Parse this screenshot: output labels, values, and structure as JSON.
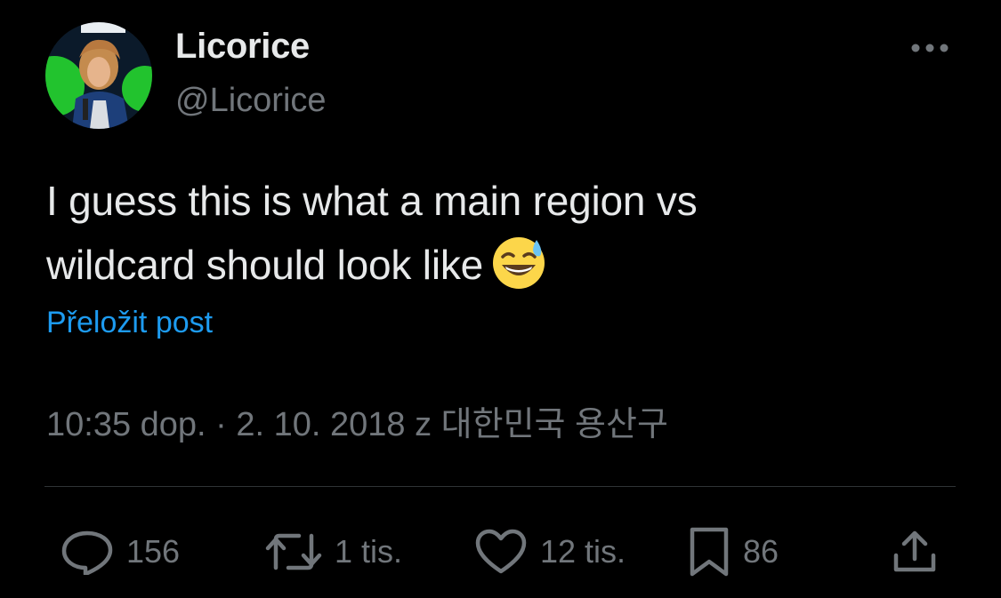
{
  "author": {
    "display_name": "Licorice",
    "handle": "@Licorice",
    "avatar_icon": "profile-photo"
  },
  "post": {
    "text_line_1": "I guess this is what a main region vs",
    "text_line_2": "wildcard should look like",
    "emoji_icon": "grinning-face-with-sweat-emoji",
    "translate_label": "Přeložit post",
    "meta": "10:35 dop. · 2. 10. 2018 z 대한민국 용산구"
  },
  "actions": {
    "replies": "156",
    "reposts": "1 tis.",
    "likes": "12 tis.",
    "bookmarks": "86"
  },
  "colors": {
    "background": "#000000",
    "text": "#e7e9ea",
    "muted": "#71767b",
    "link": "#1d9bf0",
    "divider": "#2f3336"
  }
}
